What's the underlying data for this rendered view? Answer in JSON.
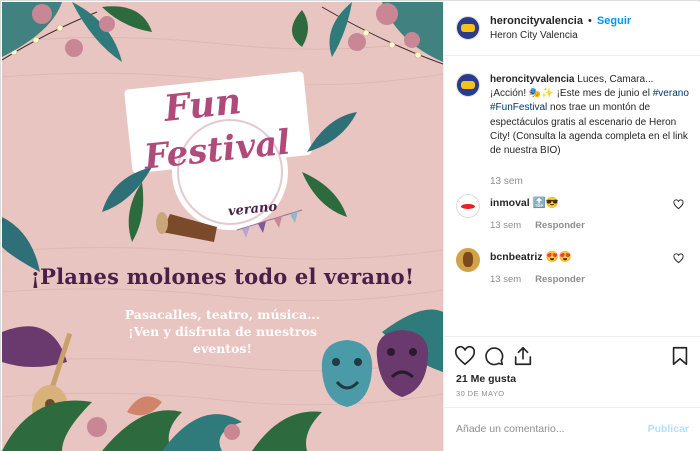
{
  "post": {
    "headline": "¡Planes molones todo el verano!",
    "subcopy": [
      "Pasacalles, teatro, música...",
      "¡Ven y disfruta de nuestros",
      "eventos!"
    ],
    "logo": {
      "line1": "Fun",
      "line2": "Festival",
      "line3": "verano"
    }
  },
  "header": {
    "username": "heroncityvalencia",
    "dot": "•",
    "follow_label": "Seguir",
    "location": "Heron City Valencia"
  },
  "caption": {
    "username": "heroncityvalencia",
    "text_1": " Luces, Camara... ¡Acción! 🎭✨ ¡Este mes de junio el ",
    "hashtag_1": "#verano",
    "text_2": " ",
    "hashtag_2": "#FunFestival",
    "text_3": " nos trae un montón de espectáculos gratis al escenario de Heron City! (Consulta la agenda completa en el link de nuestra BIO)",
    "time": "13 sem"
  },
  "comments": [
    {
      "username": "inmoval",
      "text": "🔝😎",
      "time": "13 sem",
      "reply_label": "Responder"
    },
    {
      "username": "bcnbeatriz",
      "text": "😍😍",
      "time": "13 sem",
      "reply_label": "Responder"
    }
  ],
  "actions": {
    "likes": "21 Me gusta",
    "date": "30 DE MAYO",
    "comment_placeholder": "Añade un comentario...",
    "publish_label": "Publicar"
  },
  "colors": {
    "image_bg": "#e8c5c0",
    "headline": "#4a2048",
    "link_blue": "#0095f6",
    "hashtag": "#00376b",
    "muted": "#8e8e8e"
  },
  "icons": [
    "heart-icon",
    "comment-icon",
    "share-icon",
    "bookmark-icon"
  ]
}
